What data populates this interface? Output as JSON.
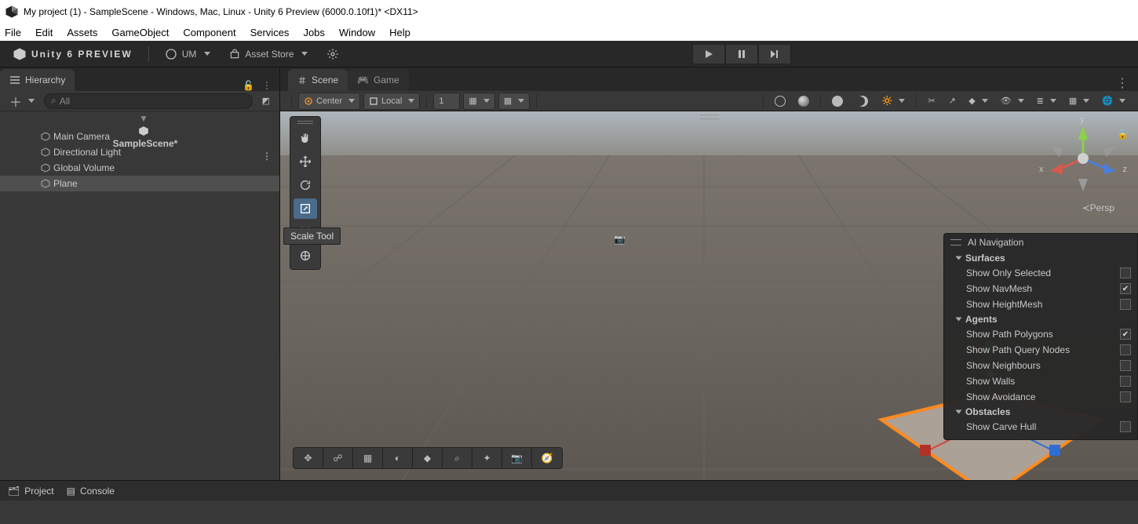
{
  "title": "My project (1) - SampleScene - Windows, Mac, Linux - Unity 6 Preview (6000.0.10f1)* <DX11>",
  "menu": [
    "File",
    "Edit",
    "Assets",
    "GameObject",
    "Component",
    "Services",
    "Jobs",
    "Window",
    "Help"
  ],
  "topbar": {
    "brand": "Unity 6 PREVIEW",
    "account": "UM",
    "asset_store": "Asset Store"
  },
  "hierarchy": {
    "tab": "Hierarchy",
    "search_placeholder": "All",
    "scene": "SampleScene*",
    "items": [
      "Main Camera",
      "Directional Light",
      "Global Volume",
      "Plane"
    ],
    "selected_index": 3
  },
  "scene": {
    "tabs": {
      "scene": "Scene",
      "game": "Game"
    },
    "pivot": "Center",
    "space": "Local",
    "grid_step": "1",
    "persp_label": "Persp",
    "axis": {
      "x": "x",
      "y": "y",
      "z": "z"
    },
    "tooltip": "Scale Tool",
    "tools": [
      "hand",
      "move",
      "rotate",
      "scale",
      "rect",
      "transform"
    ],
    "active_tool_index": 3
  },
  "aiNav": {
    "title": "AI Navigation",
    "sections": {
      "surfaces": {
        "label": "Surfaces",
        "rows": [
          {
            "label": "Show Only Selected",
            "checked": false
          },
          {
            "label": "Show NavMesh",
            "checked": true
          },
          {
            "label": "Show HeightMesh",
            "checked": false
          }
        ]
      },
      "agents": {
        "label": "Agents",
        "rows": [
          {
            "label": "Show Path Polygons",
            "checked": true
          },
          {
            "label": "Show Path Query Nodes",
            "checked": false
          },
          {
            "label": "Show Neighbours",
            "checked": false
          },
          {
            "label": "Show Walls",
            "checked": false
          },
          {
            "label": "Show Avoidance",
            "checked": false
          }
        ]
      },
      "obstacles": {
        "label": "Obstacles",
        "rows": [
          {
            "label": "Show Carve Hull",
            "checked": false
          }
        ]
      }
    }
  },
  "footer": {
    "project": "Project",
    "console": "Console"
  }
}
